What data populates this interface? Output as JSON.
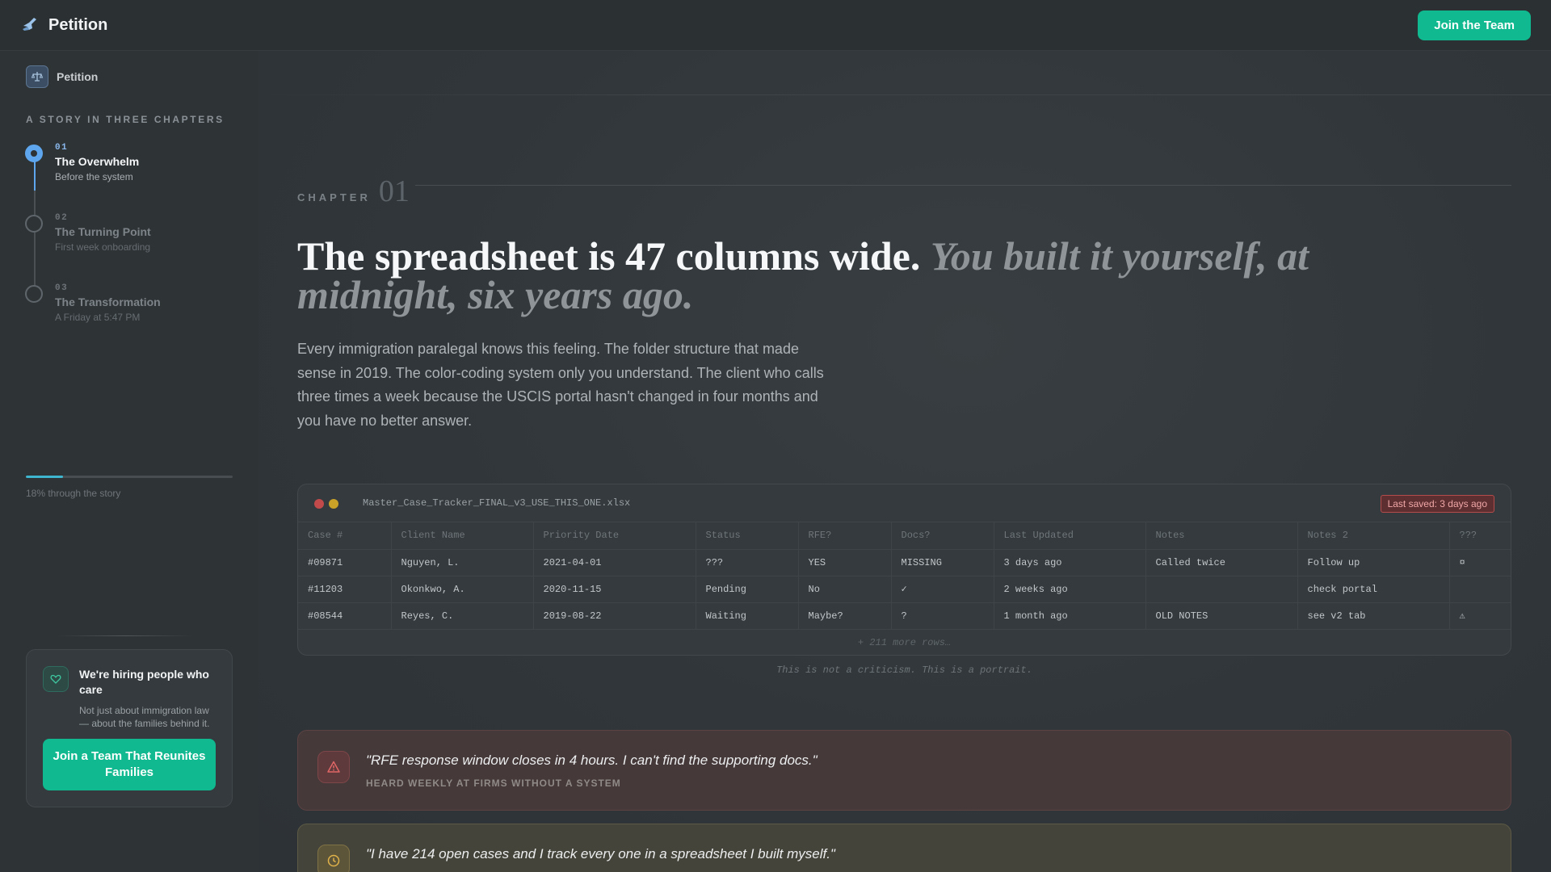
{
  "topbar": {
    "brand_title": "Petition",
    "join_button": "Join the Team"
  },
  "sidebar": {
    "brand_label": "Petition",
    "eyebrow": "A STORY IN THREE CHAPTERS",
    "chapters": [
      {
        "num": "01",
        "title": "The Overwhelm",
        "subtitle": "Before the system",
        "active": true
      },
      {
        "num": "02",
        "title": "The Turning Point",
        "subtitle": "First week onboarding",
        "active": false
      },
      {
        "num": "03",
        "title": "The Transformation",
        "subtitle": "A Friday at 5:47 PM",
        "active": false
      }
    ],
    "progress": {
      "percent": 18,
      "label": "18% through the story"
    },
    "hiring": {
      "title": "We're hiring people who care",
      "text": "Not just about immigration law — about the families behind it.",
      "button": "Join a Team That Reunites Families"
    }
  },
  "main": {
    "chapter_word": "CHAPTER",
    "chapter_number": "01",
    "headline_plain": "The spreadsheet is 47 columns wide. ",
    "headline_italic": "You built it yourself, at midnight, six years ago.",
    "lede": "Every immigration paralegal knows this feeling. The folder structure that made sense in 2019. The color-coding system only you understand. The client who calls three times a week because the USCIS portal hasn't changed in four months and you have no better answer.",
    "sheet": {
      "filename": "Master_Case_Tracker_FINAL_v3_USE_THIS_ONE.xlsx",
      "saved_badge": "Last saved: 3 days ago",
      "columns": [
        "Case #",
        "Client Name",
        "Priority Date",
        "Status",
        "RFE?",
        "Docs?",
        "Last Updated",
        "Notes",
        "Notes 2",
        "???"
      ],
      "rows": [
        [
          "#09871",
          "Nguyen, L.",
          "2021-04-01",
          "???",
          "YES",
          "MISSING",
          "3 days ago",
          "Called twice",
          "Follow up",
          "¤"
        ],
        [
          "#11203",
          "Okonkwo, A.",
          "2020-11-15",
          "Pending",
          "No",
          "✓",
          "2 weeks ago",
          "",
          "check portal",
          ""
        ],
        [
          "#08544",
          "Reyes, C.",
          "2019-08-22",
          "Waiting",
          "Maybe?",
          "?",
          "1 month ago",
          "OLD NOTES",
          "see v2 tab",
          "⚠"
        ]
      ],
      "more_rows": "+ 211 more rows…"
    },
    "caption": "This is not a criticism. This is a portrait.",
    "quotes": [
      {
        "text": "\"RFE response window closes in 4 hours. I can't find the supporting docs.\"",
        "source": "HEARD WEEKLY AT FIRMS WITHOUT A SYSTEM",
        "icon": "warning-icon",
        "accent": "#e06666"
      },
      {
        "text": "\"I have 214 open cases and I track every one in a spreadsheet I built myself.\"",
        "source": "",
        "icon": "clock-icon",
        "accent": "#e0b24a"
      }
    ]
  },
  "colors": {
    "accent_green": "#10b98f",
    "accent_blue": "#5ea7ef",
    "progress": "#3fb6d0"
  }
}
